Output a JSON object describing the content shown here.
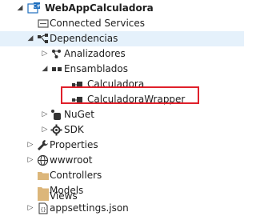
{
  "tree": {
    "project": {
      "label": "WebAppCalculadora",
      "icon": "csharp-project-icon"
    },
    "items": [
      {
        "label": "Connected Services",
        "icon": "connected-services-icon"
      },
      {
        "label": "Dependencias",
        "icon": "dependencies-icon",
        "expanded": true
      },
      {
        "label": "Analizadores",
        "icon": "analyzers-icon"
      },
      {
        "label": "Ensamblados",
        "icon": "assemblies-icon",
        "expanded": true
      },
      {
        "label": "Calculadora",
        "icon": "assembly-reference-icon"
      },
      {
        "label": "CalculadoraWrapper",
        "icon": "assembly-reference-icon",
        "highlighted": true
      },
      {
        "label": "NuGet",
        "icon": "nuget-icon"
      },
      {
        "label": "SDK",
        "icon": "sdk-icon"
      },
      {
        "label": "Properties",
        "icon": "wrench-icon"
      },
      {
        "label": "wwwroot",
        "icon": "globe-icon"
      },
      {
        "label": "Controllers",
        "icon": "folder-icon"
      },
      {
        "label": "Models",
        "icon": "folder-icon"
      },
      {
        "label": "Views",
        "icon": "folder-icon"
      },
      {
        "label": "appsettings.json",
        "icon": "json-file-icon"
      }
    ]
  },
  "colors": {
    "highlight_border": "#e0202b",
    "selection_bg": "#e5f1fb",
    "folder": "#dcb67a",
    "project_accent": "#1e6fbf"
  }
}
